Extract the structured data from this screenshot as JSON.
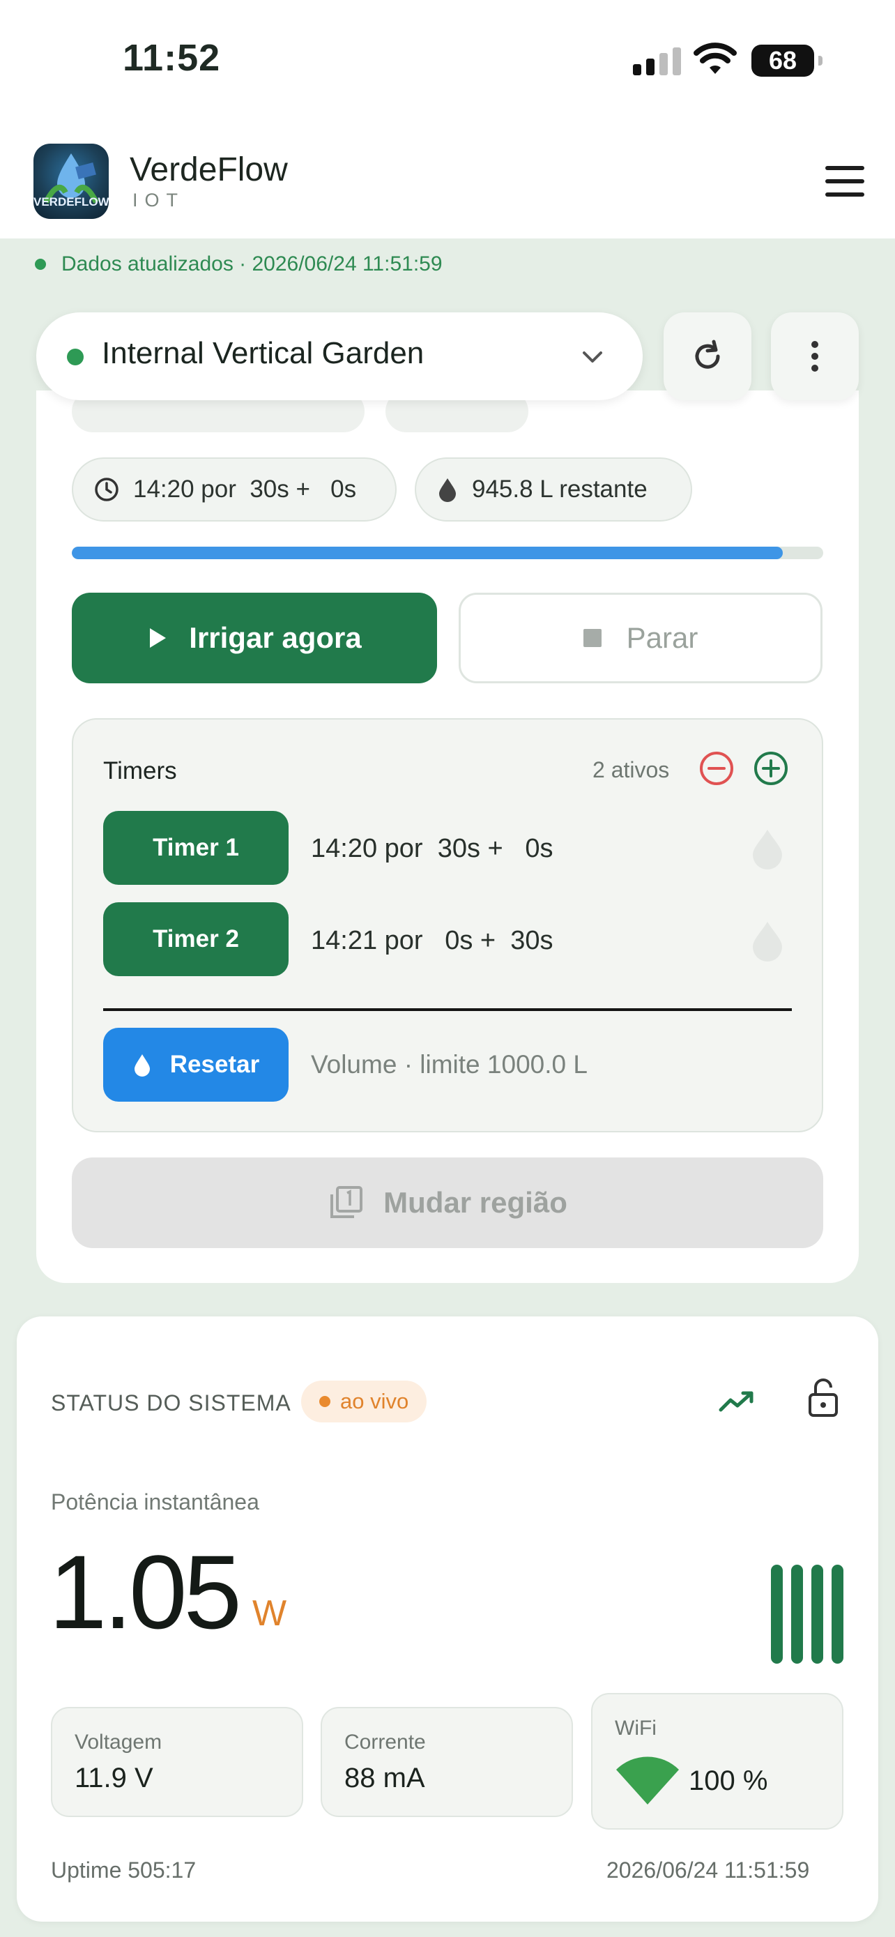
{
  "status_bar": {
    "time": "11:52",
    "battery": "68"
  },
  "header": {
    "brand": "VerdeFlow",
    "brand_sub": "IOT",
    "logo_text": "VERDEFLOW"
  },
  "banner": {
    "text": "Dados atualizados · 2026/06/24 11:51:59"
  },
  "garden": {
    "name": "Internal Vertical Garden"
  },
  "irrigation": {
    "schedule": "14:20 por  30s +   0s",
    "remaining": "945.8 L restante",
    "progress": 0.946,
    "irrigate_label": "Irrigar agora",
    "stop_label": "Parar"
  },
  "timers": {
    "title": "Timers",
    "count": "2 ativos",
    "items": [
      {
        "label": "Timer 1",
        "text": "14:20 por  30s +   0s"
      },
      {
        "label": "Timer 2",
        "text": "14:21 por   0s +  30s"
      }
    ],
    "reset_label": "Resetar",
    "volume_text": "Volume · limite 1000.0 L"
  },
  "change_region_label": "Mudar região",
  "system_status": {
    "title": "STATUS DO SISTEMA",
    "live_label": "ao vivo",
    "power_label": "Potência instantânea",
    "power_value": "1.05",
    "power_unit": "W",
    "voltage_label": "Voltagem",
    "voltage_value": "11.9 V",
    "current_label": "Corrente",
    "current_value": "88 mA",
    "wifi_label": "WiFi",
    "wifi_value": "100 %",
    "uptime": "Uptime 505:17",
    "timestamp": "2026/06/24 11:51:59"
  },
  "colors": {
    "primary_green": "#217a4b",
    "accent_blue": "#2388e6",
    "live_orange": "#e0832c",
    "danger_red": "#e05252"
  }
}
